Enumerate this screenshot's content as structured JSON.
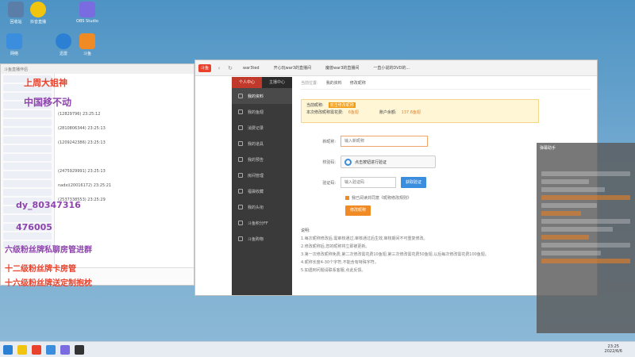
{
  "desktop_icons": [
    {
      "label": "回收站",
      "color": "#5a7ea8"
    },
    {
      "label": "抖音直播",
      "color": "#f1c40f"
    },
    {
      "label": "OBS Studio",
      "color": "#7a6ce0"
    },
    {
      "label": "网络",
      "color": "#3b8ddd"
    },
    {
      "label": "迅雷",
      "color": "#2c80d4"
    },
    {
      "label": "斗鱼",
      "color": "#f08a24"
    }
  ],
  "chat": {
    "title": "斗鱼直播伴侣",
    "messages": [
      "(12829796) 23:25:12",
      "(2810806344) 23:25:13",
      "(1209242386) 23:25:13",
      "(2475929991) 23:25:13",
      "nadxi(20016172) 23:25:21",
      "(2537338553) 23:25:29"
    ],
    "overlay_lines": [
      "上周大姐神",
      "中国移不动",
      "dy_80347316",
      "476005",
      "六级粉丝牌私聊房管进群",
      "十二级粉丝牌卡房管",
      "十六级粉丝牌送定制抱枕"
    ]
  },
  "browser": {
    "app_name": "斗鱼",
    "tabs": [
      "war3ted",
      "开心玩war3的直播间",
      "魔兽war3的直播间",
      "一直小说的DVD的..."
    ],
    "sidebar_head": [
      "个人中心",
      "主播中心"
    ],
    "sidebar_items": [
      "我的资料",
      "我的鱼翅",
      "消费记录",
      "我的道具",
      "我的预告",
      "房间管理",
      "福袋收藏",
      "我的头衔",
      "斗鱼积分FF",
      "斗鱼购物"
    ],
    "crumb": [
      "当前位置:",
      "我的资料",
      "修改昵称"
    ],
    "notice": {
      "line1_label": "当前昵称:",
      "line1_value": "双击修改昵称",
      "line2_label": "本次修改昵称需花费:",
      "line2_value": "6鱼翅",
      "balance_label": "账户余额:",
      "balance_value": "137.6鱼翅"
    },
    "form": {
      "nick_label": "新昵称:",
      "nick_placeholder": "输入新昵称",
      "verify_label": "校验码:",
      "verify_text": "点击按钮进行验证",
      "code_label": "验证码:",
      "code_placeholder": "输入验证码",
      "get_code": "获取验证",
      "agree": "我已阅读并同意《昵称修改规则》",
      "submit": "修改昵称"
    },
    "notes": {
      "title": "说明:",
      "lines": [
        "1.每次昵称修改后,需审核通过,审核通过后生效,审核期间不可重复修改。",
        "2.修改昵称后,您的昵称将立即被更新。",
        "3.第一次修改昵称免费,第二次修改需花费10鱼翅,第三次修改需花费50鱼翅,以后每次修改需花费100鱼翅。",
        "4.昵称长度4-30个字符,不能含有特殊字符。",
        "5.如遇到问题请联系客服,点此反馈。"
      ]
    }
  },
  "right_panel": {
    "title": "弹幕助手"
  },
  "taskbar": {
    "time": "23:25",
    "date": "2022/6/6"
  }
}
